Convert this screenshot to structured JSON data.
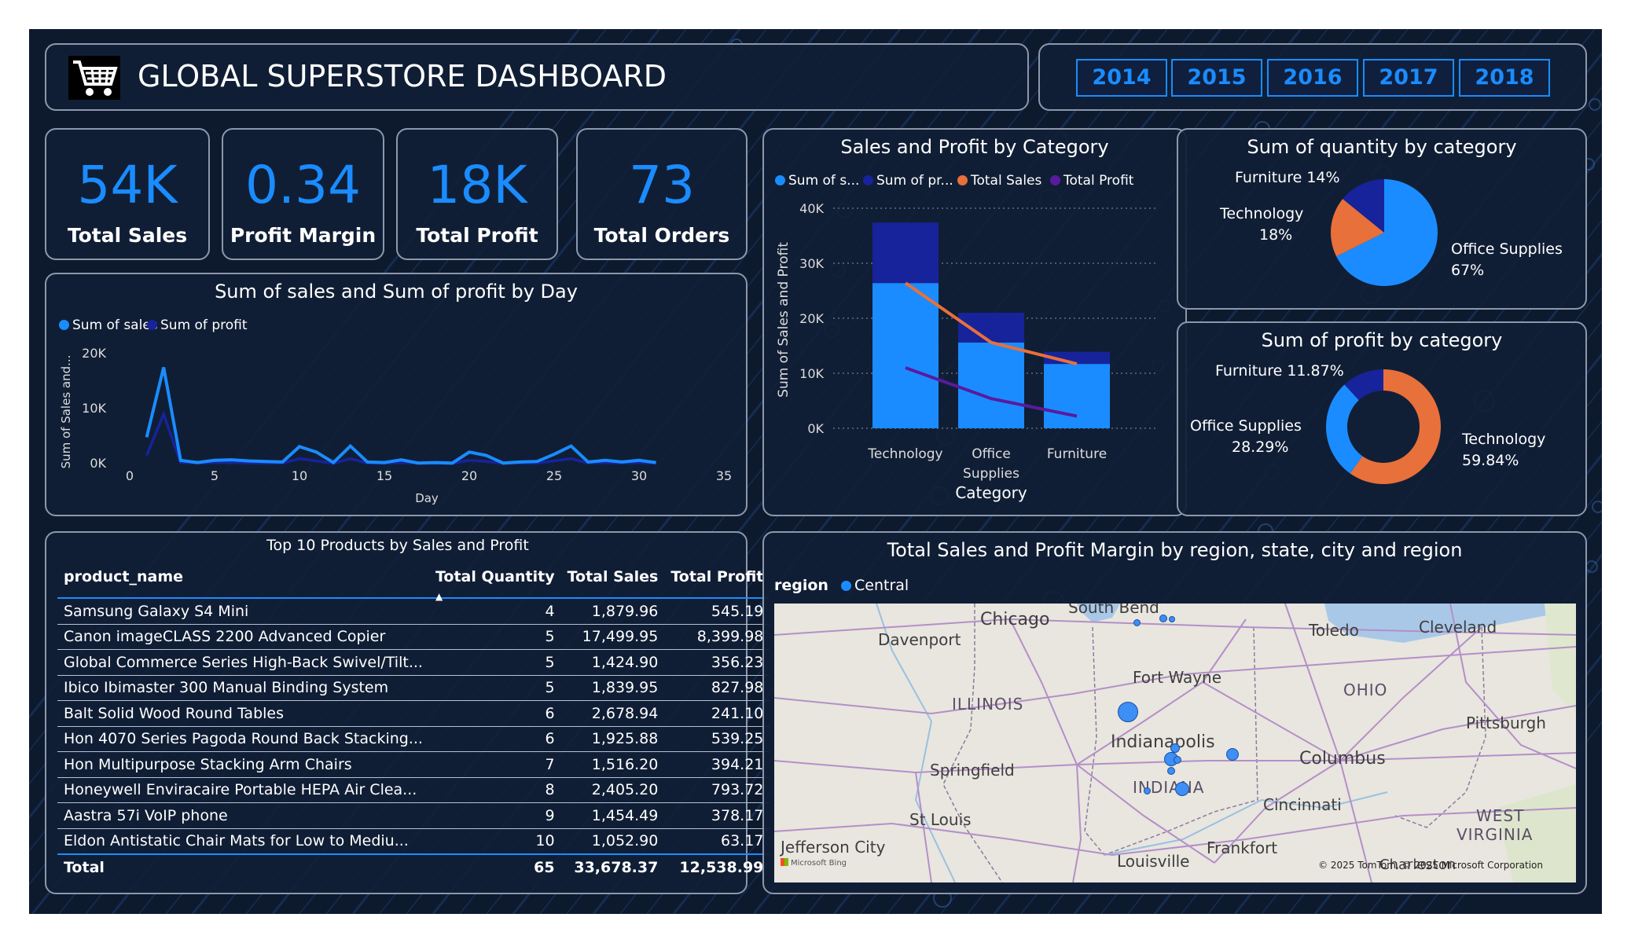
{
  "header": {
    "title": "GLOBAL SUPERSTORE DASHBOARD",
    "icon": "shopping-cart-icon"
  },
  "years": [
    "2014",
    "2015",
    "2016",
    "2017",
    "2018"
  ],
  "kpis": [
    {
      "value": "54K",
      "label": "Total Sales"
    },
    {
      "value": "0.34",
      "label": "Profit Margin"
    },
    {
      "value": "18K",
      "label": "Total Profit"
    },
    {
      "value": "73",
      "label": "Total Orders"
    }
  ],
  "colors": {
    "accent": "#1a8cff",
    "dark_blue": "#17239b",
    "orange": "#e8703a",
    "purple": "#5a1a9e",
    "background": "#0d1a2e"
  },
  "day_chart": {
    "title": "Sum of sales and Sum of profit by Day",
    "legend": [
      "Sum of sales",
      "Sum of profit"
    ],
    "ylabel": "Sum of Sales and...",
    "xlabel": "Day",
    "yticks": [
      "20K",
      "10K",
      "0K"
    ],
    "xticks": [
      "0",
      "5",
      "10",
      "15",
      "20",
      "25",
      "30",
      "35"
    ]
  },
  "category_chart": {
    "title": "Sales and Profit by Category",
    "legend": [
      "Sum of s...",
      "Sum of pr...",
      "Total Sales",
      "Total Profit"
    ],
    "ylabel": "Sum of Sales and Profit",
    "xlabel": "Category",
    "yticks": [
      "40K",
      "30K",
      "20K",
      "10K",
      "0K"
    ],
    "categories": [
      "Technology",
      "Office Supplies",
      "Furniture"
    ]
  },
  "quantity_pie": {
    "title": "Sum of quantity by category",
    "labels": {
      "furniture": "Furniture 14%",
      "technology": "Technology",
      "technology_pct": "18%",
      "office": "Office Supplies",
      "office_pct": "67%"
    }
  },
  "profit_donut": {
    "title": "Sum of profit by category",
    "labels": {
      "furniture": "Furniture 11.87%",
      "office": "Office Supplies",
      "office_pct": "28.29%",
      "technology": "Technology",
      "technology_pct": "59.84%"
    }
  },
  "top_products": {
    "title": "Top 10 Products by Sales and Profit",
    "columns": [
      "product_name",
      "Total Quantity",
      "Total Sales",
      "Total Profit"
    ],
    "rows": [
      [
        "Samsung Galaxy S4 Mini",
        "4",
        "1,879.96",
        "545.19"
      ],
      [
        "Canon imageCLASS 2200 Advanced Copier",
        "5",
        "17,499.95",
        "8,399.98"
      ],
      [
        "Global Commerce Series High-Back Swivel/Tilt...",
        "5",
        "1,424.90",
        "356.23"
      ],
      [
        "Ibico Ibimaster 300 Manual Binding System",
        "5",
        "1,839.95",
        "827.98"
      ],
      [
        "Balt Solid Wood Round Tables",
        "6",
        "2,678.94",
        "241.10"
      ],
      [
        "Hon 4070 Series Pagoda Round Back Stacking...",
        "6",
        "1,925.88",
        "539.25"
      ],
      [
        "Hon Multipurpose Stacking Arm Chairs",
        "7",
        "1,516.20",
        "394.21"
      ],
      [
        "Honeywell Enviracaire Portable HEPA Air Clea...",
        "8",
        "2,405.20",
        "793.72"
      ],
      [
        "Aastra 57i VoIP phone",
        "9",
        "1,454.49",
        "378.17"
      ],
      [
        "Eldon Antistatic Chair Mats for Low to Mediu...",
        "10",
        "1,052.90",
        "63.17"
      ]
    ],
    "total": [
      "Total",
      "65",
      "33,678.37",
      "12,538.99"
    ]
  },
  "map": {
    "title": "Total Sales and Profit Margin by region, state, city and region",
    "legend_title": "region",
    "legend_item": "Central",
    "cities": [
      "South Bend",
      "Chicago",
      "Toledo",
      "Cleveland",
      "Davenport",
      "Fort Wayne",
      "Indianapolis",
      "Springfield",
      "Columbus",
      "Pittsburgh",
      "Cincinnati",
      "St Louis",
      "Frankfort",
      "Jefferson City",
      "Louisville",
      "Charleston"
    ],
    "states": [
      "ILLINOIS",
      "OHIO",
      "INDIANA",
      "WEST",
      "VIRGINIA"
    ],
    "copyright": "© 2025 TomTom, © 2025 Microsoft Corporation",
    "bing": "Microsoft Bing"
  },
  "chart_data": [
    {
      "type": "line",
      "title": "Sum of sales and Sum of profit by Day",
      "xlabel": "Day",
      "ylabel": "Sum of Sales and...",
      "xlim": [
        0,
        35
      ],
      "ylim": [
        0,
        20000
      ],
      "x": [
        1,
        2,
        3,
        4,
        5,
        6,
        7,
        8,
        9,
        10,
        11,
        12,
        13,
        14,
        15,
        16,
        17,
        18,
        19,
        20,
        21,
        22,
        23,
        24,
        25,
        26,
        27,
        28,
        29,
        30,
        31
      ],
      "series": [
        {
          "name": "Sum of sales",
          "values": [
            4800,
            17500,
            600,
            200,
            600,
            700,
            500,
            400,
            300,
            3100,
            2100,
            200,
            3200,
            300,
            200,
            700,
            100,
            200,
            100,
            2100,
            1500,
            100,
            300,
            400,
            1700,
            3200,
            300,
            600,
            300,
            600,
            200
          ]
        },
        {
          "name": "Sum of profit",
          "values": [
            1500,
            9000,
            200,
            100,
            200,
            200,
            100,
            100,
            100,
            900,
            500,
            50,
            900,
            100,
            50,
            200,
            50,
            50,
            50,
            600,
            400,
            50,
            100,
            100,
            500,
            900,
            100,
            200,
            100,
            200,
            50
          ]
        }
      ]
    },
    {
      "type": "bar",
      "title": "Sales and Profit by Category",
      "xlabel": "Category",
      "ylabel": "Sum of Sales and Profit",
      "ylim": [
        0,
        40000
      ],
      "categories": [
        "Technology",
        "Office Supplies",
        "Furniture"
      ],
      "series": [
        {
          "name": "Sum of s...",
          "values": [
            26400,
            15600,
            11700
          ]
        },
        {
          "name": "Sum of pr...",
          "values": [
            11000,
            5400,
            2200
          ]
        },
        {
          "name": "Total Sales",
          "values": [
            26400,
            15600,
            11700
          ]
        },
        {
          "name": "Total Profit",
          "values": [
            11000,
            5400,
            2200
          ]
        }
      ]
    },
    {
      "type": "pie",
      "title": "Sum of quantity by category",
      "categories": [
        "Office Supplies",
        "Technology",
        "Furniture"
      ],
      "values": [
        67,
        18,
        14
      ]
    },
    {
      "type": "pie",
      "title": "Sum of profit by category",
      "categories": [
        "Technology",
        "Office Supplies",
        "Furniture"
      ],
      "values": [
        59.84,
        28.29,
        11.87
      ]
    }
  ]
}
